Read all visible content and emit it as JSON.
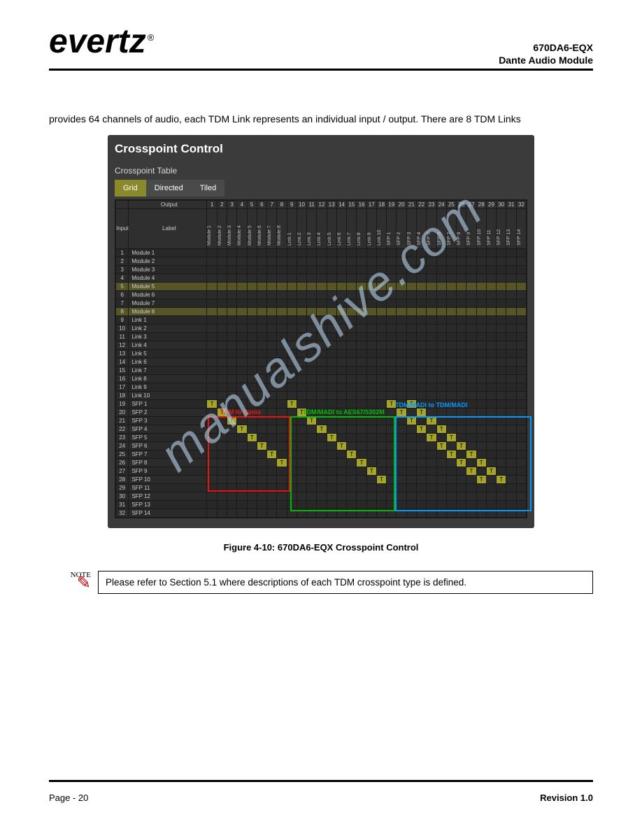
{
  "logo_text": "evertz",
  "doc_title": "670DA6-EQX",
  "doc_sub": "Dante Audio Module",
  "intro": "provides 64 channels of audio, each TDM Link represents an individual input / output. There are 8 TDM Links",
  "ui": {
    "title": "Crosspoint Control",
    "subhead": "Crosspoint Table",
    "tabs": [
      "Grid",
      "Directed",
      "Tiled"
    ],
    "h_output": "Output",
    "h_input": "Input",
    "h_label": "Label",
    "col_nums": [
      "1",
      "2",
      "3",
      "4",
      "5",
      "6",
      "7",
      "8",
      "9",
      "10",
      "11",
      "12",
      "13",
      "14",
      "15",
      "16",
      "17",
      "18",
      "19",
      "20",
      "21",
      "22",
      "23",
      "24",
      "25",
      "26",
      "27",
      "28",
      "29",
      "30",
      "31",
      "32"
    ],
    "col_labels": [
      "Module 1",
      "Module 2",
      "Module 3",
      "Module 4",
      "Module 5",
      "Module 6",
      "Module 7",
      "Module 8",
      "Link 1",
      "Link 2",
      "Link 3",
      "Link 4",
      "Link 5",
      "Link 6",
      "Link 7",
      "Link 8",
      "Link 9",
      "Link 10",
      "SFP 1",
      "SFP 2",
      "SFP 3",
      "SFP 4",
      "SFP 5",
      "SFP 6",
      "SFP 7",
      "SFP 8",
      "SFP 9",
      "SFP 10",
      "SFP 11",
      "SFP 12",
      "SFP 13",
      "SFP 14"
    ],
    "rows": [
      {
        "n": "1",
        "label": "Module 1"
      },
      {
        "n": "2",
        "label": "Module 2"
      },
      {
        "n": "3",
        "label": "Module 3"
      },
      {
        "n": "4",
        "label": "Module 4"
      },
      {
        "n": "5",
        "label": "Module 5"
      },
      {
        "n": "6",
        "label": "Module 6"
      },
      {
        "n": "7",
        "label": "Module 7"
      },
      {
        "n": "8",
        "label": "Module 8"
      },
      {
        "n": "9",
        "label": "Link 1"
      },
      {
        "n": "10",
        "label": "Link 2"
      },
      {
        "n": "11",
        "label": "Link 3"
      },
      {
        "n": "12",
        "label": "Link 4"
      },
      {
        "n": "13",
        "label": "Link 5"
      },
      {
        "n": "14",
        "label": "Link 6"
      },
      {
        "n": "15",
        "label": "Link 7"
      },
      {
        "n": "16",
        "label": "Link 8"
      },
      {
        "n": "17",
        "label": "Link 9"
      },
      {
        "n": "18",
        "label": "Link 10"
      },
      {
        "n": "19",
        "label": "SFP 1"
      },
      {
        "n": "20",
        "label": "SFP 2"
      },
      {
        "n": "21",
        "label": "SFP 3"
      },
      {
        "n": "22",
        "label": "SFP 4"
      },
      {
        "n": "23",
        "label": "SFP 5"
      },
      {
        "n": "24",
        "label": "SFP 6"
      },
      {
        "n": "25",
        "label": "SFP 7"
      },
      {
        "n": "26",
        "label": "SFP 8"
      },
      {
        "n": "27",
        "label": "SFP 9"
      },
      {
        "n": "28",
        "label": "SFP 10"
      },
      {
        "n": "29",
        "label": "SFP 11"
      },
      {
        "n": "30",
        "label": "SFP 12"
      },
      {
        "n": "31",
        "label": "SFP 13"
      },
      {
        "n": "32",
        "label": "SFP 14"
      }
    ],
    "anno_red": "TDM to Dante",
    "anno_green": "TDM/MADI to AES67/5302M",
    "anno_blue": "TDM/MADI to TDM/MADI"
  },
  "caption": "Figure 4-10: 670DA6-EQX Crosspoint Control",
  "note_label": "NOTE",
  "note_text": "Please refer to Section 5.1 where descriptions of each TDM crosspoint type is defined.",
  "footer_left": "Page - 20",
  "footer_right": "Revision 1.0"
}
